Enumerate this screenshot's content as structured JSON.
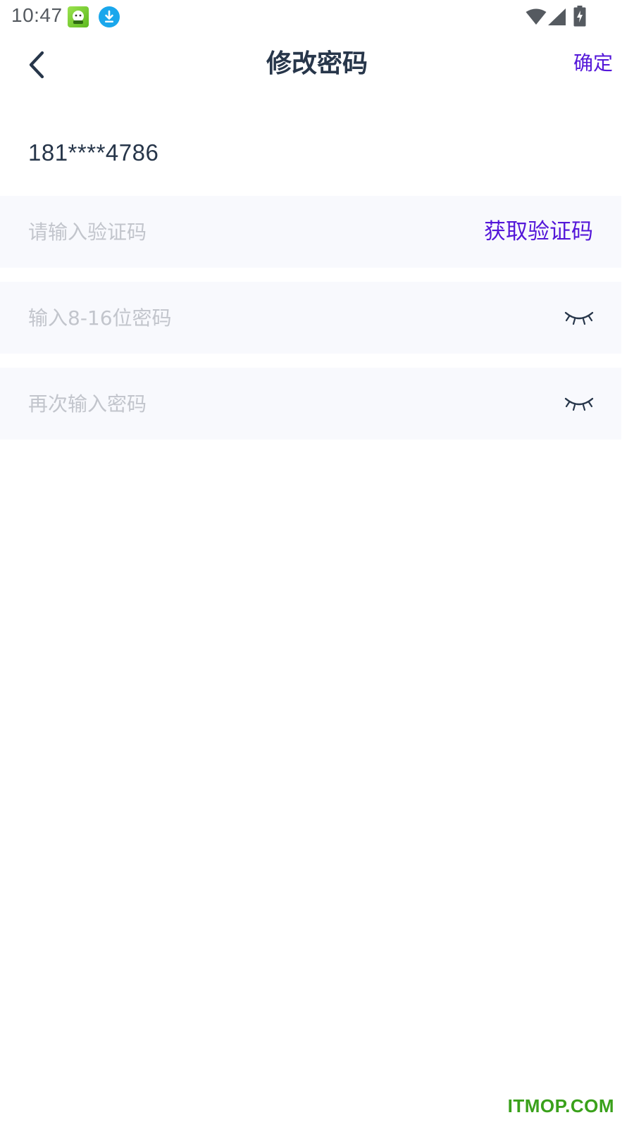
{
  "status_bar": {
    "time": "10:47",
    "icons": [
      "app-notification-icon",
      "download-icon",
      "wifi-icon",
      "signal-icon",
      "battery-charging-icon"
    ]
  },
  "header": {
    "title": "修改密码",
    "confirm_label": "确定",
    "back_icon": "chevron-left-icon"
  },
  "account": {
    "phone": "181****4786"
  },
  "form": {
    "code_placeholder": "请输入验证码",
    "get_code_label": "获取验证码",
    "new_password_placeholder": "输入8-16位密码",
    "repeat_password_placeholder": "再次输入密码",
    "password_toggle_icon": "eye-closed-icon"
  },
  "watermark": "ITMOP.COM",
  "colors": {
    "accent": "#5417d9",
    "title": "#27364a",
    "placeholder": "#c2c5cc",
    "field_background": "#f8f9fd",
    "watermark": "#3aa11b"
  }
}
